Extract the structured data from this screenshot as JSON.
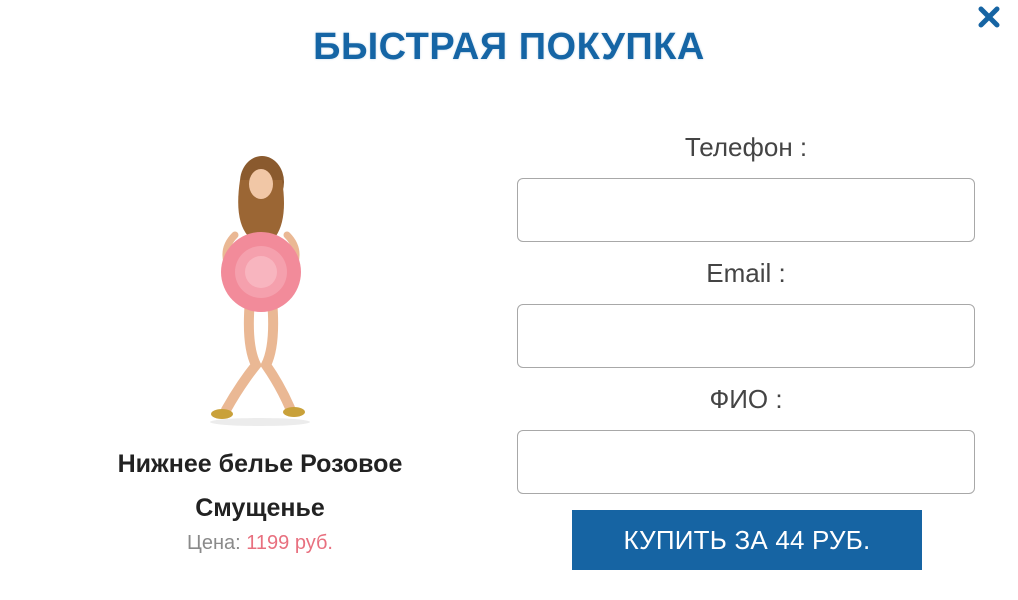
{
  "modal": {
    "title": "БЫСТРАЯ ПОКУПКА",
    "close_icon": "close-icon"
  },
  "product": {
    "name": "Нижнее белье Розовое Смущенье",
    "price_label": "Цена:",
    "price_value": "1199 руб."
  },
  "form": {
    "phone_label": "Телефон :",
    "email_label": "Email :",
    "name_label": "ФИО :",
    "phone_value": "",
    "email_value": "",
    "name_value": "",
    "submit_label": "КУПИТЬ ЗА 44 РУБ."
  },
  "colors": {
    "accent": "#1664a3",
    "title": "#1565a5",
    "price": "#e8707f",
    "hat": "#f28b9a"
  }
}
